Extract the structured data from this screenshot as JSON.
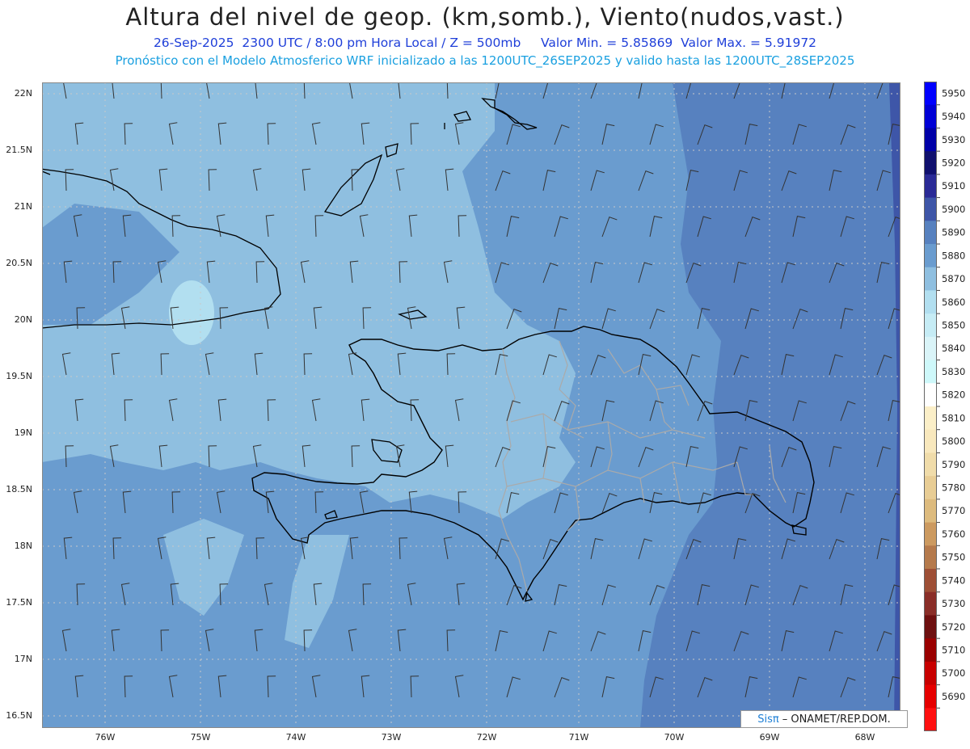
{
  "title": "Altura del nivel de geop. (km,somb.), Viento(nudos,vast.)",
  "subtitle_line1": "26-Sep-2025  2300 UTC / 8:00 pm Hora Local / Z = 500mb     Valor Min. = 5.85869  Valor Max. = 5.91972",
  "subtitle_line2": "Pronóstico con el Modelo Atmosferico WRF inicializado a las 1200UTC_26SEP2025 y valido hasta las  1200UTC_28SEP2025",
  "lat_labels": [
    "22N",
    "21.5N",
    "21N",
    "20.5N",
    "20N",
    "19.5N",
    "19N",
    "18.5N",
    "18N",
    "17.5N",
    "17N",
    "16.5N"
  ],
  "lon_labels": [
    "76W",
    "75W",
    "74W",
    "73W",
    "72W",
    "71W",
    "70W",
    "69W",
    "68W"
  ],
  "colorbar": {
    "labels": [
      "5950",
      "5940",
      "5930",
      "5920",
      "5910",
      "5900",
      "5890",
      "5880",
      "5870",
      "5860",
      "5850",
      "5840",
      "5830",
      "5820",
      "5810",
      "5800",
      "5790",
      "5780",
      "5770",
      "5760",
      "5750",
      "5740",
      "5730",
      "5720",
      "5710",
      "5700",
      "5690"
    ],
    "colors": [
      "#0000ff",
      "#0000d6",
      "#0000a8",
      "#10106e",
      "#2a2a96",
      "#3e56a8",
      "#5781bf",
      "#6a9ccf",
      "#8fbfe0",
      "#b2dff0",
      "#c6ecf5",
      "#daf4f8",
      "#cef8fa",
      "#ffffff",
      "#fbefc8",
      "#f8e8bd",
      "#f0dcaa",
      "#e8cd95",
      "#ddbb7e",
      "#cc9a60",
      "#b57a4c",
      "#9e4f36",
      "#8a2e28",
      "#6e1010",
      "#9a0000",
      "#c80000",
      "#e60000",
      "#ff1010"
    ]
  },
  "map_colors": {
    "light": "#8fbfe0",
    "mid": "#6a9ccf",
    "deep": "#5781bf",
    "spot": "#b2dff0",
    "edge": "#3e56a8",
    "coast": "#000000",
    "province": "#aaaaaa"
  },
  "credit": {
    "brand": "Sisπ",
    "text": "– ONAMET/REP.DOM."
  }
}
